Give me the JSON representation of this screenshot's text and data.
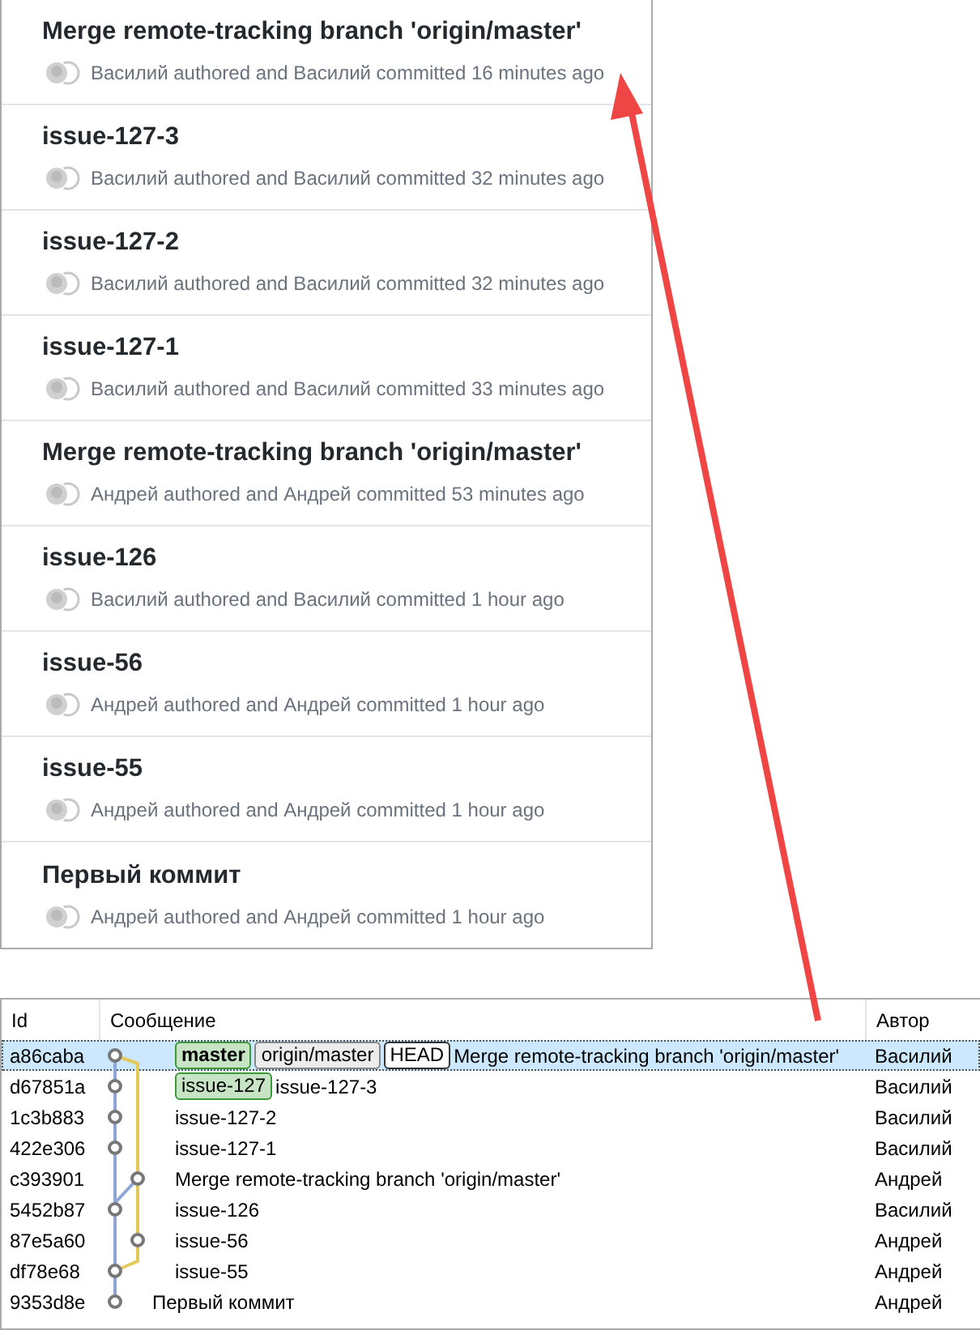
{
  "commits": [
    {
      "title": "Merge remote-tracking branch 'origin/master'",
      "meta": "Василий authored and Василий committed 16 minutes ago"
    },
    {
      "title": "issue-127-3",
      "meta": "Василий authored and Василий committed 32 minutes ago"
    },
    {
      "title": "issue-127-2",
      "meta": "Василий authored and Василий committed 32 minutes ago"
    },
    {
      "title": "issue-127-1",
      "meta": "Василий authored and Василий committed 33 minutes ago"
    },
    {
      "title": "Merge remote-tracking branch 'origin/master'",
      "meta": "Андрей authored and Андрей committed 53 minutes ago"
    },
    {
      "title": "issue-126",
      "meta": "Василий authored and Василий committed 1 hour ago"
    },
    {
      "title": "issue-56",
      "meta": "Андрей authored and Андрей committed 1 hour ago"
    },
    {
      "title": "issue-55",
      "meta": "Андрей authored and Андрей committed 1 hour ago"
    },
    {
      "title": "Первый коммит",
      "meta": "Андрей authored and Андрей committed 1 hour ago"
    }
  ],
  "table": {
    "columns": [
      "Id",
      "Сообщение",
      "Автор"
    ],
    "rows": [
      {
        "id": "a86caba",
        "refs": [
          {
            "kind": "local",
            "label": "master",
            "current": true
          },
          {
            "kind": "remote",
            "label": "origin/master"
          },
          {
            "kind": "head",
            "label": "HEAD"
          }
        ],
        "message": "Merge remote-tracking branch 'origin/master'",
        "author": "Василий",
        "selected": true
      },
      {
        "id": "d67851a",
        "refs": [
          {
            "kind": "local",
            "label": "issue-127",
            "current": false
          }
        ],
        "message": "issue-127-3",
        "author": "Василий",
        "selected": false
      },
      {
        "id": "1c3b883",
        "message": "issue-127-2",
        "author": "Василий",
        "selected": false
      },
      {
        "id": "422e306",
        "message": "issue-127-1",
        "author": "Василий",
        "selected": false
      },
      {
        "id": "c393901",
        "message": "Merge remote-tracking branch 'origin/master'",
        "author": "Андрей",
        "selected": false
      },
      {
        "id": "5452b87",
        "message": "issue-126",
        "author": "Василий",
        "selected": false
      },
      {
        "id": "87e5a60",
        "message": "issue-56",
        "author": "Андрей",
        "selected": false
      },
      {
        "id": "df78e68",
        "message": "issue-55",
        "author": "Андрей",
        "selected": false
      },
      {
        "id": "9353d8e",
        "message": "Первый коммит",
        "author": "Андрей",
        "selected": false
      }
    ]
  }
}
